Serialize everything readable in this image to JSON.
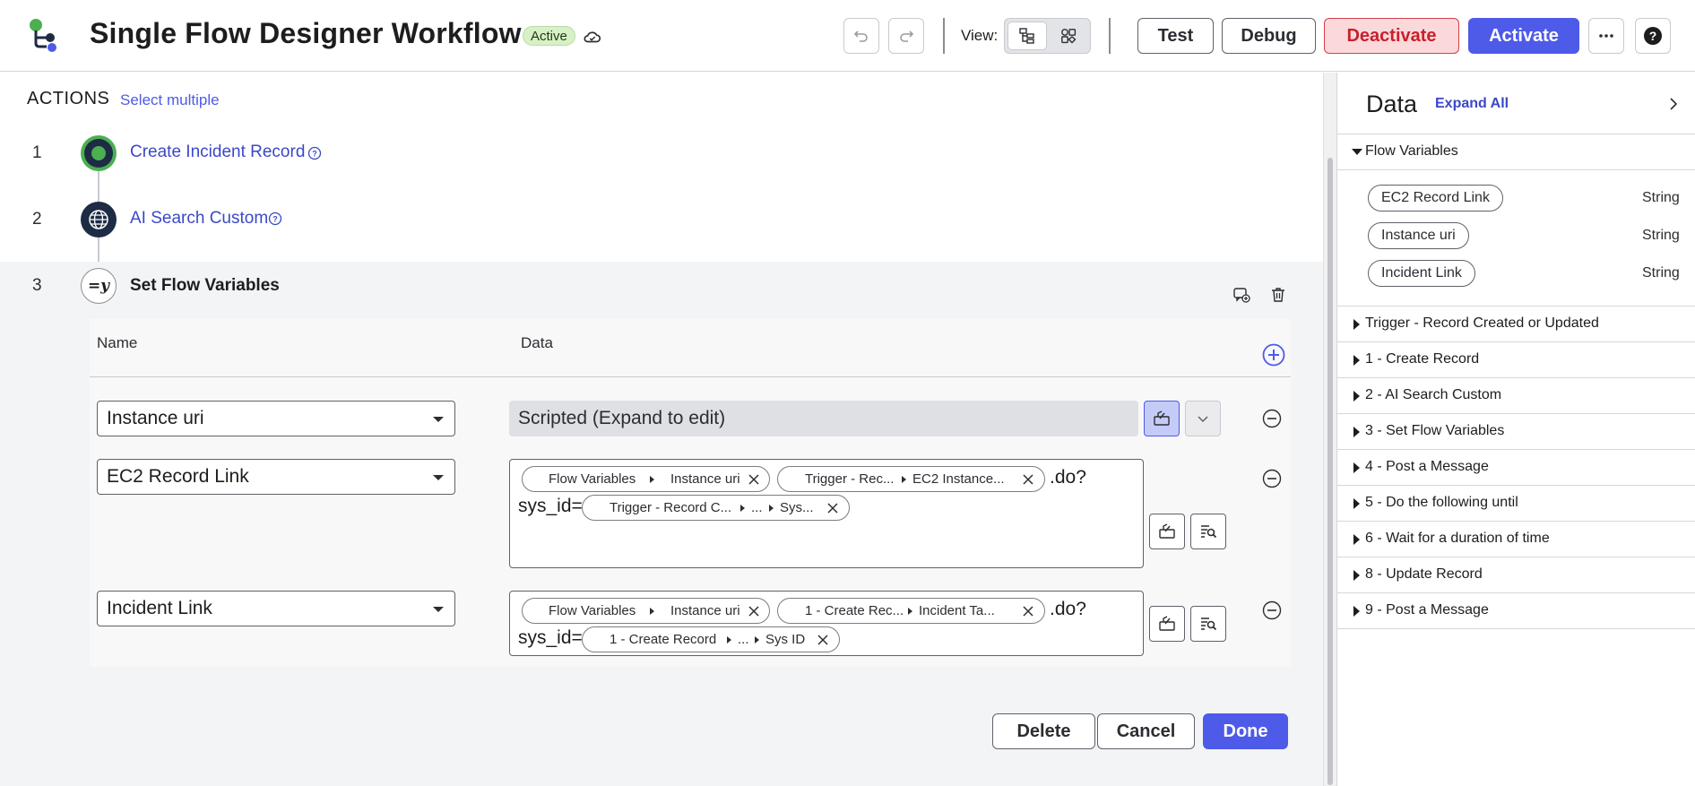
{
  "header": {
    "title": "Single Flow Designer Workflow",
    "status": "Active",
    "view_label": "View:",
    "buttons": {
      "test": "Test",
      "debug": "Debug",
      "deactivate": "Deactivate",
      "activate": "Activate"
    },
    "icons": [
      "logo-icon",
      "cloud-icon",
      "undo-icon",
      "redo-icon",
      "tree-view-icon",
      "grid-view-icon",
      "more-icon",
      "help-icon"
    ]
  },
  "canvas": {
    "actions_label": "ACTIONS",
    "select_multiple": "Select multiple",
    "steps": [
      {
        "num": "1",
        "label": "Create Incident Record"
      },
      {
        "num": "2",
        "label": "AI Search Custom"
      },
      {
        "num": "3",
        "label": "Set Flow Variables"
      }
    ],
    "table": {
      "col_name": "Name",
      "col_data": "Data",
      "rows": [
        {
          "name": "Instance uri",
          "data": "Scripted (Expand to edit)"
        },
        {
          "name": "EC2 Record Link",
          "pills": [
            {
              "a": "Flow Variables",
              "b": "Instance uri"
            },
            {
              "a": "Trigger - Rec...",
              "b": "EC2 Instance..."
            },
            {
              "a": "Trigger - Record C...",
              "b": "...",
              "c": "Sys..."
            }
          ],
          "suffix": ".do?",
          "prefix2": "sys_id="
        },
        {
          "name": "Incident Link",
          "pills": [
            {
              "a": "Flow Variables",
              "b": "Instance uri"
            },
            {
              "a": "1 - Create Rec...",
              "b": "Incident Ta..."
            },
            {
              "a": "1 - Create Record",
              "b": "...",
              "c": "Sys ID"
            }
          ],
          "suffix": ".do?",
          "prefix2": "sys_id="
        }
      ]
    },
    "footer": {
      "delete": "Delete",
      "cancel": "Cancel",
      "done": "Done"
    }
  },
  "panel": {
    "title": "Data",
    "expand_all": "Expand All",
    "flow_variables_label": "Flow Variables",
    "variables": [
      {
        "name": "EC2 Record Link",
        "type": "String"
      },
      {
        "name": "Instance uri",
        "type": "String"
      },
      {
        "name": "Incident Link",
        "type": "String"
      }
    ],
    "sections": [
      "Trigger - Record Created or Updated",
      "1 - Create Record",
      "2 - AI Search Custom",
      "3 - Set Flow Variables",
      "4 - Post a Message",
      "5 - Do the following until",
      "6 - Wait for a duration of time",
      "8 - Update Record",
      "9 - Post a Message"
    ]
  },
  "colors": {
    "accent": "#4e5ae8",
    "link": "#3b48c8",
    "danger": "#c8202c",
    "active_badge": "#d8f0c8"
  }
}
